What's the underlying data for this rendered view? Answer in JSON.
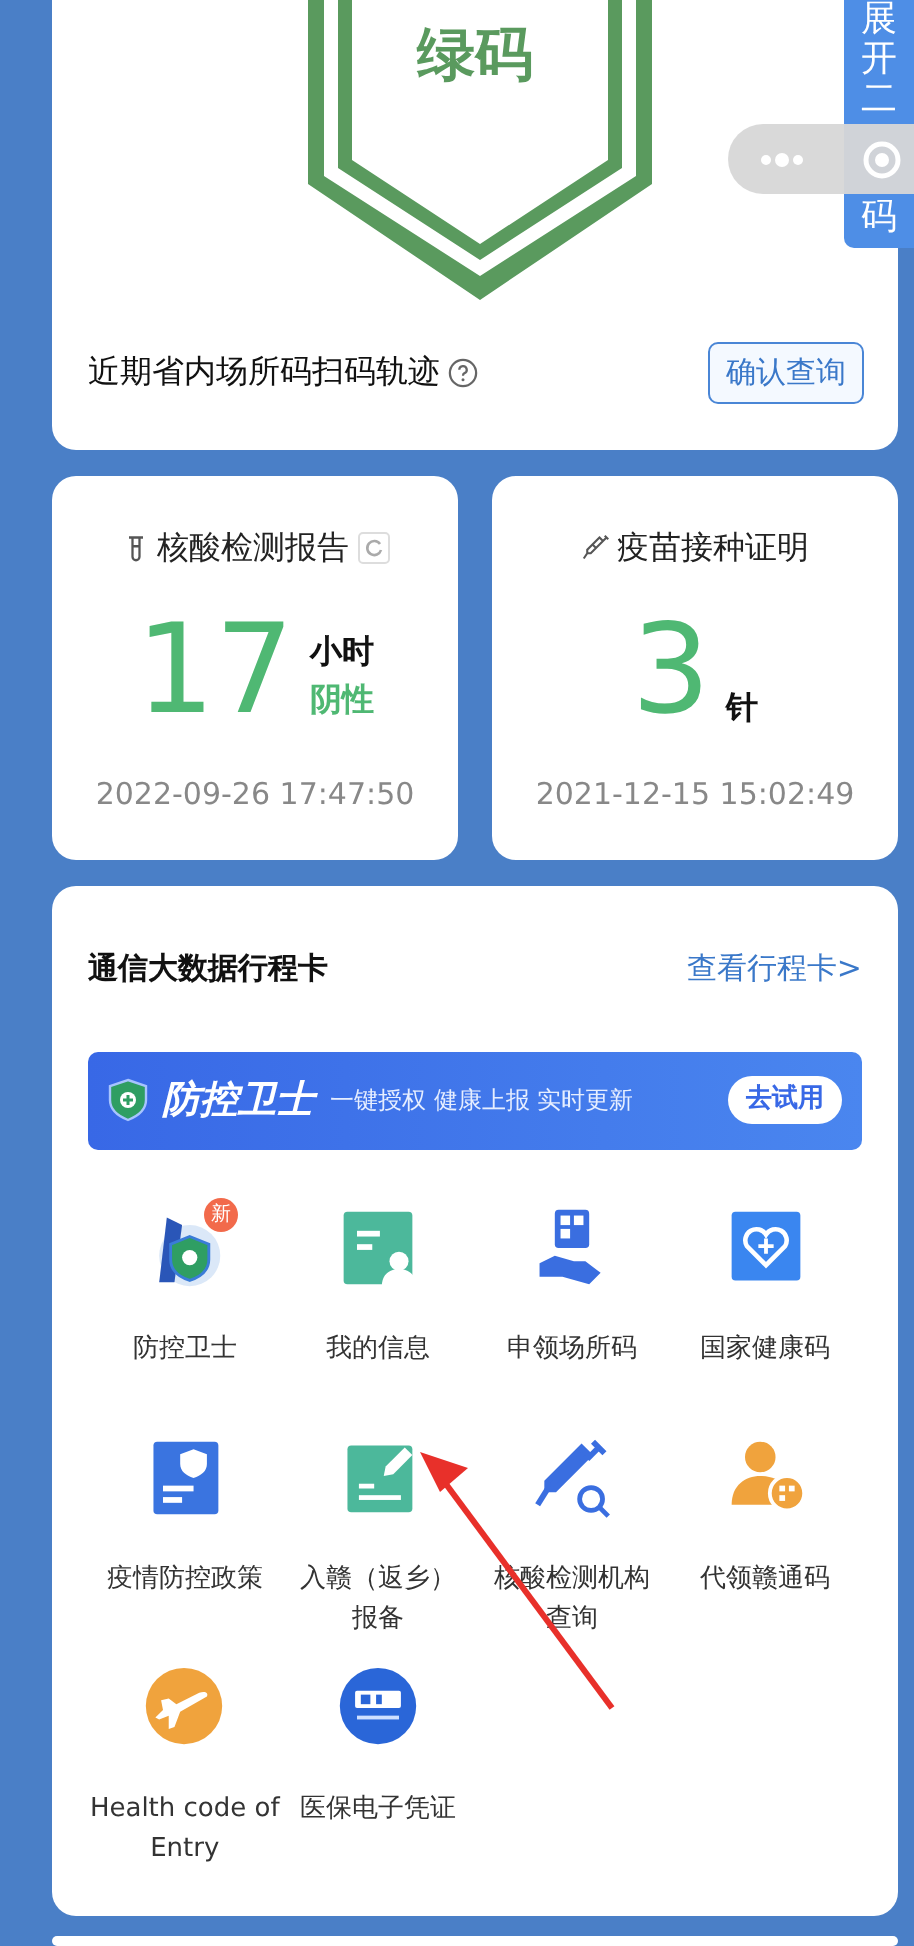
{
  "health_code": {
    "status": "绿码",
    "trace_label": "近期省内场所码扫码轨迹",
    "confirm_button": "确认查询"
  },
  "side_tab": {
    "text_top": "展开二",
    "text_bottom": "码"
  },
  "stat_cards": [
    {
      "kind": "nucleic",
      "title": "核酸检测报告",
      "value": "17",
      "unit": "小时",
      "result": "阴性",
      "time": "2022-09-26 17:47:50"
    },
    {
      "kind": "vaccine",
      "title": "疫苗接种证明",
      "value": "3",
      "unit": "针",
      "time": "2021-12-15 15:02:49"
    }
  ],
  "itinerary": {
    "title": "通信大数据行程卡",
    "link": "查看行程卡>"
  },
  "banner": {
    "brand": "防控卫士",
    "slogan": "一键授权 健康上报 实时更新",
    "button": "去试用"
  },
  "services": [
    {
      "kind": "guard",
      "lines": [
        "防控卫士"
      ],
      "badge": "新"
    },
    {
      "kind": "profile",
      "lines": [
        "我的信息"
      ]
    },
    {
      "kind": "venue",
      "lines": [
        "申领场所码"
      ]
    },
    {
      "kind": "health",
      "lines": [
        "国家健康码"
      ]
    },
    {
      "kind": "policy",
      "lines": [
        "疫情防控政策"
      ]
    },
    {
      "kind": "report",
      "lines": [
        "入赣（返乡）",
        "报备"
      ]
    },
    {
      "kind": "testsite",
      "lines": [
        "核酸检测机构",
        "查询"
      ]
    },
    {
      "kind": "proxy",
      "lines": [
        "代领赣通码"
      ]
    },
    {
      "kind": "flight",
      "lines": [
        "Health code of",
        "Entry"
      ]
    },
    {
      "kind": "insurance",
      "lines": [
        "医保电子凭证"
      ]
    }
  ]
}
